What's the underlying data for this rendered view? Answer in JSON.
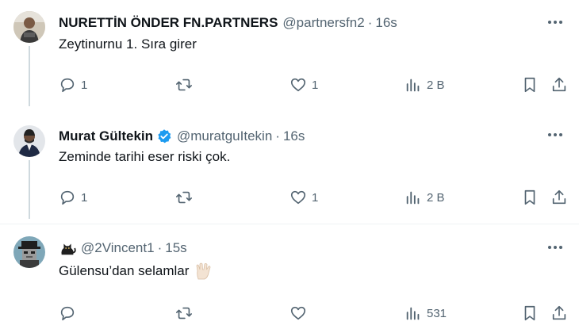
{
  "tweets": [
    {
      "name": "NURETTİN ÖNDER FN.PARTNERS",
      "handle": "@partnersfn2",
      "dot": "·",
      "time": "16s",
      "verified": false,
      "text": "Zeytinurnu 1. Sıra girer",
      "counts": {
        "reply": "1",
        "retweet": "",
        "like": "1",
        "views": "2 B"
      }
    },
    {
      "name": "Murat Gültekin",
      "handle": "@muratguItekin",
      "dot": "·",
      "time": "16s",
      "verified": true,
      "text": "Zeminde tarihi eser riski çok.",
      "counts": {
        "reply": "1",
        "retweet": "",
        "like": "1",
        "views": "2 B"
      }
    },
    {
      "name": "",
      "handle": "@2Vincent1",
      "dot": "·",
      "time": "15s",
      "verified": false,
      "name_emoji": "cat-emoji",
      "text": "Gülensu’dan selamlar",
      "text_emoji": "vulcan-salute-emoji",
      "counts": {
        "reply": "",
        "retweet": "",
        "like": "",
        "views": "531"
      }
    }
  ],
  "colors": {
    "text": "#0f1419",
    "secondary": "#536471",
    "verified": "#1d9bf0",
    "divider": "#eff3f4",
    "thread": "#cfd9de"
  }
}
